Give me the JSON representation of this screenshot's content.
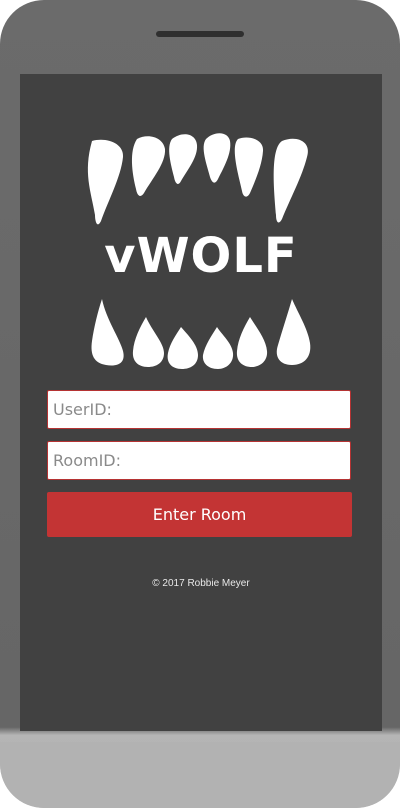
{
  "app": {
    "logo_text": "vWOLF",
    "logo_icon": "fang-teeth-icon"
  },
  "form": {
    "userid_placeholder": "UserID:",
    "roomid_placeholder": "RoomID:",
    "enter_label": "Enter Room"
  },
  "footer": {
    "copyright": "© 2017 Robbie Meyer"
  },
  "colors": {
    "phone_body": "#666666",
    "screen": "#414141",
    "accent": "#c33434",
    "phone_chin": "#b2b2b2"
  }
}
